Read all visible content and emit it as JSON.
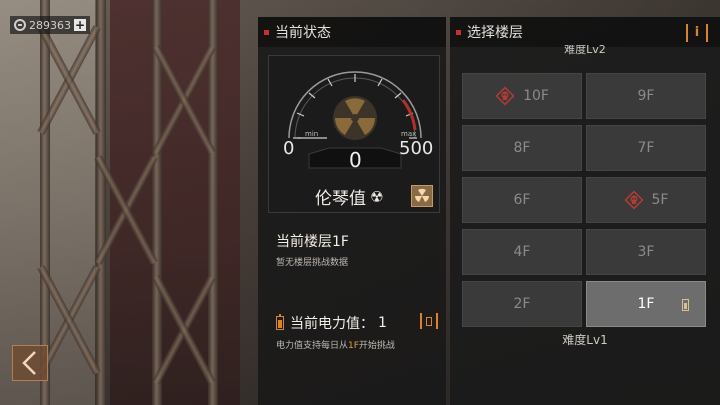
{
  "currency": {
    "amount": "289363",
    "add_label": "+"
  },
  "left_panel": {
    "title": "当前状态",
    "gauge": {
      "min_label": "min",
      "max_label": "max",
      "min_value": "0",
      "max_value": "500",
      "current_value": "0",
      "name": "伦琴值",
      "symbol": "☢"
    },
    "floor": {
      "title": "当前楼层1F",
      "subtitle": "暂无楼层挑战数据"
    },
    "power": {
      "label": "当前电力值：",
      "value": "1",
      "desc_prefix": "电力值支持每日从",
      "desc_highlight": "1F",
      "desc_suffix": "开始挑战"
    }
  },
  "right_panel": {
    "title": "选择楼层",
    "info_label": "i",
    "level_top": "难度Lv2",
    "level_bottom": "难度Lv1",
    "floors": [
      {
        "label": "10F",
        "boss": true,
        "active": false
      },
      {
        "label": "9F",
        "boss": false,
        "active": false
      },
      {
        "label": "8F",
        "boss": false,
        "active": false
      },
      {
        "label": "7F",
        "boss": false,
        "active": false
      },
      {
        "label": "6F",
        "boss": false,
        "active": false
      },
      {
        "label": "5F",
        "boss": true,
        "active": false
      },
      {
        "label": "4F",
        "boss": false,
        "active": false
      },
      {
        "label": "3F",
        "boss": false,
        "active": false
      },
      {
        "label": "2F",
        "boss": false,
        "active": false
      },
      {
        "label": "1F",
        "boss": false,
        "active": true
      }
    ]
  },
  "colors": {
    "accent": "#d9832b",
    "danger": "#c8302a",
    "floor_btn": "#3a3a3a",
    "floor_btn_active": "#6d6d6d"
  }
}
